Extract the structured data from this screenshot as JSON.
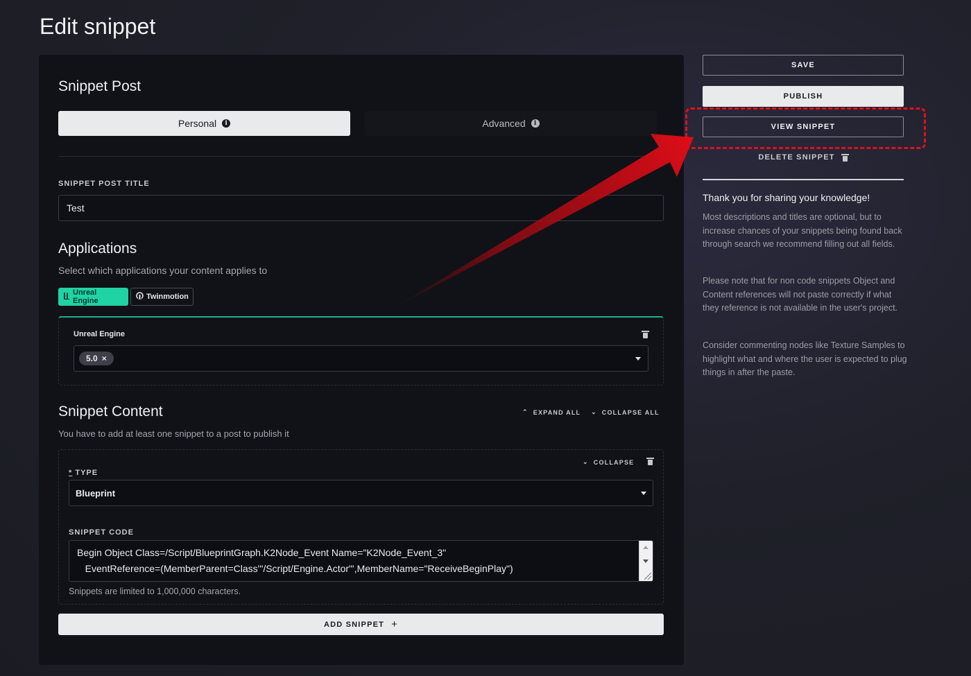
{
  "page": {
    "title": "Edit snippet"
  },
  "post": {
    "heading": "Snippet Post",
    "tabs": [
      {
        "label": "Personal",
        "active": true
      },
      {
        "label": "Advanced",
        "active": false
      }
    ],
    "title_label": "SNIPPET POST TITLE",
    "title_value": "Test"
  },
  "applications": {
    "heading": "Applications",
    "subtitle": "Select which applications your content applies to",
    "tags": [
      {
        "label": "Unreal Engine",
        "selected": true,
        "icon": "unreal-engine-icon",
        "color": "#1fd3a4"
      },
      {
        "label": "Twinmotion",
        "selected": false,
        "icon": "twinmotion-icon"
      }
    ],
    "unreal_box": {
      "title": "Unreal Engine",
      "versions": [
        "5.0"
      ],
      "remove_symbol": "×"
    }
  },
  "content": {
    "heading": "Snippet Content",
    "subtitle": "You have to add at least one snippet to a post to publish it",
    "expand_all": "EXPAND ALL",
    "collapse_all": "COLLAPSE ALL",
    "snippet": {
      "collapse": "COLLAPSE",
      "required_marker": "*",
      "type_label": "TYPE",
      "type_value": "Blueprint",
      "code_label": "SNIPPET CODE",
      "code_lines": [
        "Begin Object Class=/Script/BlueprintGraph.K2Node_Event Name=\"K2Node_Event_3\"",
        "   EventReference=(MemberParent=Class'\"/Script/Engine.Actor\"',MemberName=\"ReceiveBeginPlay\")"
      ],
      "limit_note": "Snippets are limited to 1,000,000 characters."
    },
    "add_snippet": "ADD SNIPPET",
    "add_symbol": "+"
  },
  "sidebar": {
    "save": "SAVE",
    "publish": "PUBLISH",
    "view": "VIEW SNIPPET",
    "delete": "DELETE SNIPPET",
    "thank_title": "Thank you for sharing your knowledge!",
    "paragraphs": [
      "Most descriptions and titles are optional, but to increase chances of your snippets being found back through search we recommend filling out all fields.",
      "Please note that for non code snippets Object and Content references will not paste correctly if what they reference is not available in the user's project.",
      "Consider commenting nodes like Texture Samples to highlight what and where the user is expected to plug things in after the paste."
    ]
  },
  "annotation": {
    "color": "#e0101d",
    "target": "VIEW SNIPPET"
  }
}
